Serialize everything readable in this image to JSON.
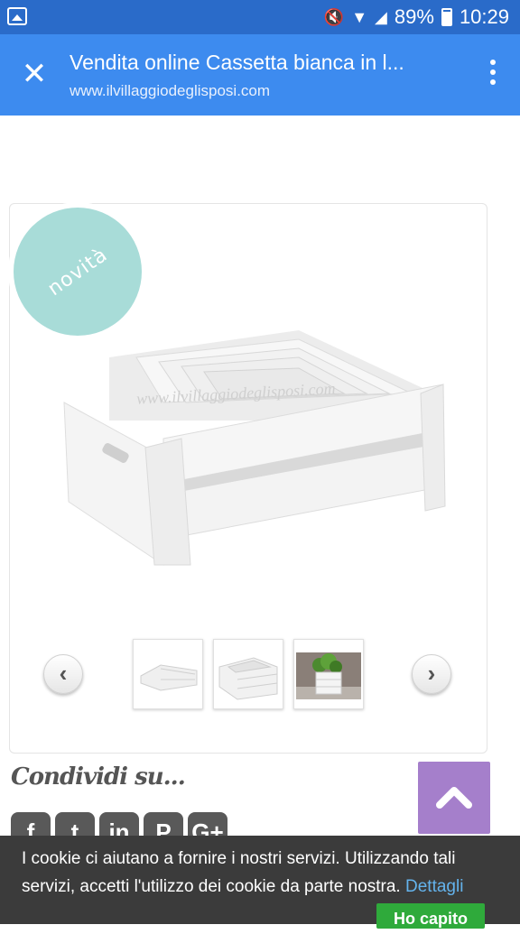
{
  "status_bar": {
    "battery": "89%",
    "time": "10:29"
  },
  "toolbar": {
    "title": "Vendita online Cassetta bianca in l...",
    "url": "www.ilvillaggiodeglisposi.com"
  },
  "product": {
    "badge": "novità",
    "watermark": "www.ilvillaggiodeglisposi.com"
  },
  "share": {
    "label": "Condividi su..."
  },
  "cookie": {
    "text": "I cookie ci aiutano a fornire i nostri servizi. Utilizzando tali servizi, accetti l'utilizzo dei cookie da parte nostra.",
    "link": "Dettagli",
    "button": "Ho capito"
  },
  "colors": {
    "status_bar": "#2a6bc9",
    "toolbar": "#3d8bef",
    "badge": "#a8dcd8",
    "scroll_top": "#a57fcb",
    "cookie_bg": "#3b3b3b",
    "cookie_link": "#64b3ec",
    "cookie_button": "#2faa3b"
  }
}
